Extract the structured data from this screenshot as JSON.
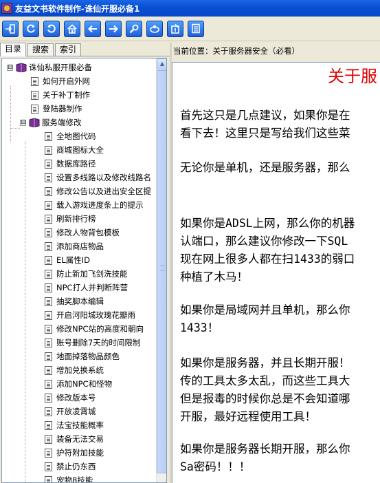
{
  "window": {
    "title": "友益文书软件制作-诛仙开服必备1"
  },
  "toolbar": {
    "buttons": [
      {
        "name": "exit-icon"
      },
      {
        "name": "refresh-icon"
      },
      {
        "name": "back-circle-icon"
      },
      {
        "name": "home-icon"
      },
      {
        "name": "left-arrow-icon"
      },
      {
        "name": "right-arrow-icon"
      },
      {
        "name": "search-icon"
      },
      {
        "name": "link-icon"
      },
      {
        "name": "bookmark-icon"
      },
      {
        "name": "notes-icon"
      }
    ]
  },
  "tabs": [
    {
      "label": "目录",
      "active": true
    },
    {
      "label": "搜索",
      "active": false
    },
    {
      "label": "索引",
      "active": false
    }
  ],
  "tree": {
    "root": {
      "label": "诛仙私服开服必备",
      "expander": "⊟"
    },
    "top_items": [
      "如何开启外网",
      "关于补丁制作",
      "登陆器制作"
    ],
    "folder": {
      "label": "服务端修改",
      "expander": "⊟"
    },
    "children": [
      "全地图代码",
      "商城图标大全",
      "数据库路径",
      "设置多线路以及修改线路名",
      "修改公告以及进出安全区提",
      "载入游戏进度条上的提示",
      "刷新排行榜",
      "修改人物背包模板",
      "添加商店物品",
      "EL属性ID",
      "防止新加飞剑洗技能",
      "NPC打人并判断阵营",
      "抽奖脚本编辑",
      "开启河阳城玫瑰花瓣雨",
      "修改NPC站的高度和朝向",
      "账号删除7天的时间限制",
      "地面掉落物品颜色",
      "增加兑换系统",
      "添加NPC和怪物",
      "修改版本号",
      "开放凌霄城",
      "法宝技能概率",
      "装备无法交易",
      "护符附加技能",
      "禁止仍东西",
      "宠物8技能"
    ]
  },
  "breadcrumb": {
    "text": "当前位置：关于服务器安全（必看）"
  },
  "document": {
    "title": "关于服",
    "paragraphs": [
      [
        "首先这只是几点建议，如果你是在",
        "看下去！这里只是写给我们这些菜"
      ],
      [
        "无论你是单机，还是服务器，那么"
      ],
      [
        "如果你是ADSL上网，那么你的机器",
        "认端口，那么建议你修改一下SQL",
        "现在网上很多人都在扫1433的弱口",
        "种植了木马！"
      ],
      [
        "如果你是局域网并且单机，那么你",
        "1433！"
      ],
      [
        "如果你是服务器，并且长期开服！",
        "传的工具太多太乱，而这些工具大",
        "但是报毒的时候你总是不会知道哪",
        "开服，最好远程使用工具！"
      ],
      [
        "如果你是服务器长期开服，那么你",
        "Sa密码！！！"
      ]
    ]
  }
}
